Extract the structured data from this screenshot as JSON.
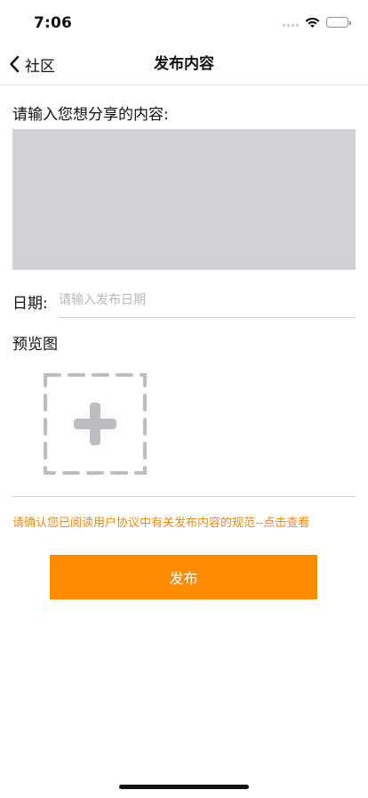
{
  "status_bar": {
    "time": "7:06",
    "icons": [
      "cellular-signal-icon",
      "wifi-icon",
      "battery-icon"
    ]
  },
  "nav": {
    "back_icon": "chevron-left-icon",
    "back_label": "社区",
    "title": "发布内容"
  },
  "form": {
    "content_label": "请输入您想分享的内容:",
    "content_value": "",
    "date_label": "日期:",
    "date_placeholder": "请输入发布日期",
    "date_value": "",
    "preview_label": "预览图",
    "add_image_icon": "dashed-plus-icon"
  },
  "agreement_text": "请确认您已阅读用户协议中有关发布内容的规范--点击查看",
  "publish_label": "发布",
  "colors": {
    "accent": "#ff8c00",
    "agreement_text": "#f08a12",
    "textarea_bg": "#d2d2d6",
    "placeholder": "#b8b8bc",
    "icon_gray": "#bdbdc2"
  }
}
